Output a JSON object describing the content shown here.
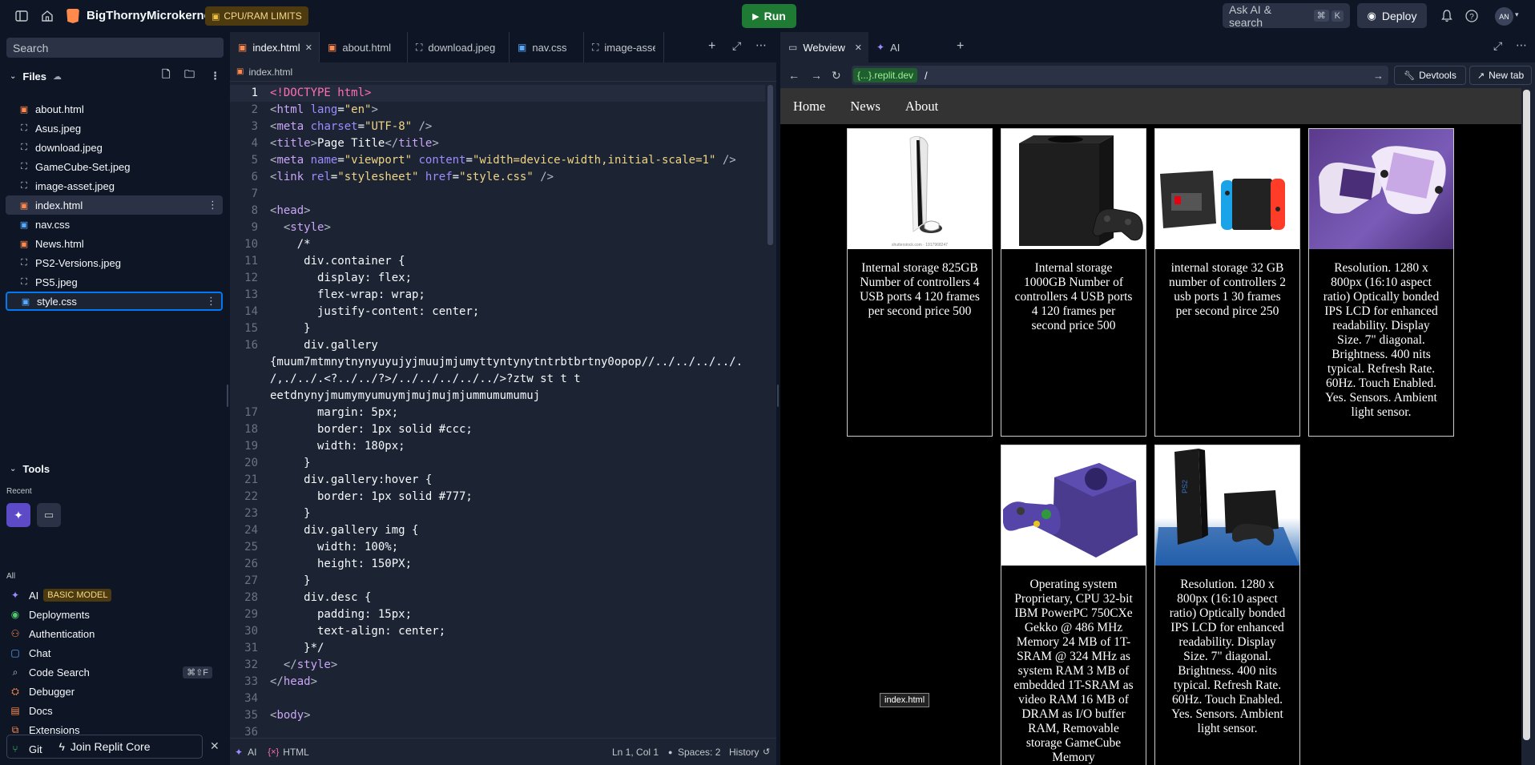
{
  "topbar": {
    "project_name": "BigThornyMicrokernel",
    "limits_badge": "CPU/RAM LIMITS",
    "run_label": "Run",
    "search_label": "Ask AI & search",
    "shortcut_cmd": "⌘",
    "shortcut_k": "K",
    "deploy_label": "Deploy",
    "avatar_initials": "AN"
  },
  "sidebar": {
    "search_placeholder": "Search",
    "files_header": "Files",
    "files": [
      {
        "name": "about.html",
        "type": "html"
      },
      {
        "name": "Asus.jpeg",
        "type": "img"
      },
      {
        "name": "download.jpeg",
        "type": "img"
      },
      {
        "name": "GameCube-Set.jpeg",
        "type": "img"
      },
      {
        "name": "image-asset.jpeg",
        "type": "img"
      },
      {
        "name": "index.html",
        "type": "html"
      },
      {
        "name": "nav.css",
        "type": "css"
      },
      {
        "name": "News.html",
        "type": "html"
      },
      {
        "name": "PS2-Versions.jpeg",
        "type": "img"
      },
      {
        "name": "PS5.jpeg",
        "type": "img"
      },
      {
        "name": "style.css",
        "type": "css"
      }
    ],
    "tools_header": "Tools",
    "recent_label": "Recent",
    "all_label": "All",
    "ai_badge": "BASIC MODEL",
    "tools": [
      {
        "name": "AI",
        "icon": "ai-icon"
      },
      {
        "name": "Deployments",
        "icon": "deployments-icon"
      },
      {
        "name": "Authentication",
        "icon": "auth-icon"
      },
      {
        "name": "Chat",
        "icon": "chat-icon"
      },
      {
        "name": "Code Search",
        "icon": "search-icon",
        "shortcut": "⌘⇧F"
      },
      {
        "name": "Debugger",
        "icon": "debugger-icon"
      },
      {
        "name": "Docs",
        "icon": "docs-icon"
      },
      {
        "name": "Extensions",
        "icon": "extensions-icon"
      },
      {
        "name": "Git",
        "icon": "git-icon"
      }
    ],
    "join_label": "Join Replit Core"
  },
  "editor": {
    "tabs": [
      "index.html",
      "about.html",
      "download.jpeg",
      "nav.css",
      "image-asset.j"
    ],
    "breadcrumb": "index.html",
    "status": {
      "ai": "AI",
      "lang": "HTML",
      "position": "Ln 1, Col 1",
      "spaces": "Spaces: 2",
      "history": "History"
    }
  },
  "webpane": {
    "tabs": [
      "Webview",
      "AI"
    ],
    "url_domain": "{...}.replit.dev",
    "url_path": "/",
    "devtools_label": "Devtools",
    "newtab_label": "New tab",
    "nav": [
      "Home",
      "News",
      "About"
    ],
    "tooltip": "index.html",
    "cards": [
      {
        "desc": "Internal storage 825GB Number of controllers 4 USB ports 4 120 frames per second price 500"
      },
      {
        "desc": "Internal storage 1000GB Number of controllers 4 USB ports 4 120 frames per second price 500"
      },
      {
        "desc": "internal storage 32 GB number of controllers 2 usb ports 1 30 frames per second pirce 250"
      },
      {
        "desc": "Resolution. 1280 x 800px (16:10 aspect ratio) Optically bonded IPS LCD for enhanced readability. Display Size. 7\" diagonal. Brightness. 400 nits typical. Refresh Rate. 60Hz. Touch Enabled. Yes. Sensors. Ambient light sensor."
      },
      {
        "desc": "Operating system Proprietary, CPU 32-bit IBM PowerPC 750CXe Gekko @ 486 MHz Memory 24 MB of 1T-SRAM @ 324 MHz as system RAM 3 MB of embedded 1T-SRAM as video RAM 16 MB of DRAM as I/O buffer RAM, Removable storage GameCube Memory"
      },
      {
        "desc": "Resolution. 1280 x 800px (16:10 aspect ratio) Optically bonded IPS LCD for enhanced readability. Display Size. 7\" diagonal. Brightness. 400 nits typical. Refresh Rate. 60Hz. Touch Enabled. Yes. Sensors. Ambient light sensor."
      }
    ]
  },
  "colors": {
    "run_green": "#1f7a34",
    "accent_blue": "#0079f2",
    "badge_bg": "#4d3b0f",
    "badge_fg": "#f0c040"
  }
}
